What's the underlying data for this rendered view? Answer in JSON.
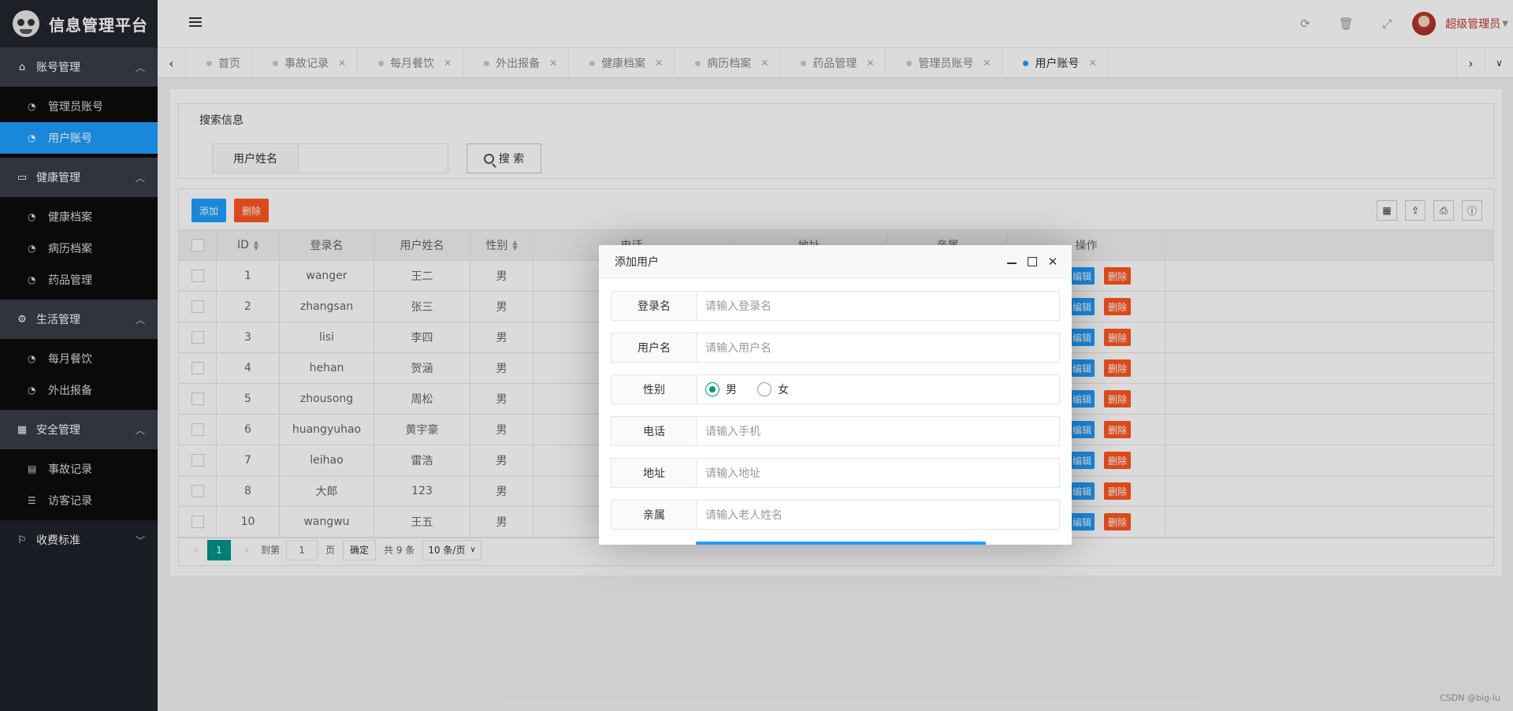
{
  "app": {
    "title": "信息管理平台"
  },
  "sidebar": {
    "groups": [
      {
        "label": "账号管理",
        "icon": "home-icon",
        "items": [
          {
            "label": "管理员账号",
            "icon": "dashboard-icon"
          },
          {
            "label": "用户账号",
            "icon": "dashboard-icon",
            "active": true
          }
        ]
      },
      {
        "label": "健康管理",
        "icon": "window-icon",
        "items": [
          {
            "label": "健康档案",
            "icon": "dashboard-icon"
          },
          {
            "label": "病历档案",
            "icon": "dashboard-icon"
          },
          {
            "label": "药品管理",
            "icon": "dashboard-icon"
          }
        ]
      },
      {
        "label": "生活管理",
        "icon": "gears-icon",
        "items": [
          {
            "label": "每月餐饮",
            "icon": "dashboard-icon"
          },
          {
            "label": "外出报备",
            "icon": "dashboard-icon"
          }
        ]
      },
      {
        "label": "安全管理",
        "icon": "calendar-icon",
        "items": [
          {
            "label": "事故记录",
            "icon": "list-alt-icon"
          },
          {
            "label": "访客记录",
            "icon": "list-icon"
          }
        ]
      },
      {
        "label": "收费标准",
        "icon": "flag-icon",
        "items": []
      }
    ]
  },
  "header": {
    "admin_name": "超级管理员"
  },
  "tabs": [
    {
      "label": "首页"
    },
    {
      "label": "事故记录"
    },
    {
      "label": "每月餐饮"
    },
    {
      "label": "外出报备"
    },
    {
      "label": "健康档案"
    },
    {
      "label": "病历档案"
    },
    {
      "label": "药品管理"
    },
    {
      "label": "管理员账号"
    },
    {
      "label": "用户账号",
      "active": true
    }
  ],
  "search": {
    "legend": "搜索信息",
    "label": "用户姓名",
    "value": "",
    "button": "搜 索"
  },
  "toolbar": {
    "add_label": "添加",
    "delete_label": "删除"
  },
  "table": {
    "headers": {
      "id": "ID",
      "login": "登录名",
      "name": "用户姓名",
      "sex": "性别",
      "phone": "电话",
      "addr": "地址",
      "rel": "亲属",
      "op": "操作"
    },
    "edit_label": "编辑",
    "delete_label": "删除",
    "rows": [
      {
        "id": "1",
        "login": "wanger",
        "name": "王二",
        "sex": "男"
      },
      {
        "id": "2",
        "login": "zhangsan",
        "name": "张三",
        "sex": "男"
      },
      {
        "id": "3",
        "login": "lisi",
        "name": "李四",
        "sex": "男"
      },
      {
        "id": "4",
        "login": "hehan",
        "name": "贺涵",
        "sex": "男"
      },
      {
        "id": "5",
        "login": "zhousong",
        "name": "周松",
        "sex": "男"
      },
      {
        "id": "6",
        "login": "huangyuhao",
        "name": "黄宇豪",
        "sex": "男"
      },
      {
        "id": "7",
        "login": "leihao",
        "name": "雷浩",
        "sex": "男"
      },
      {
        "id": "8",
        "login": "大郎",
        "name": "123",
        "sex": "男"
      },
      {
        "id": "10",
        "login": "wangwu",
        "name": "王五",
        "sex": "男"
      }
    ]
  },
  "pager": {
    "current": "1",
    "goto_label": "到第",
    "goto_value": "1",
    "page_unit": "页",
    "confirm": "确定",
    "total": "共 9 条",
    "page_size": "10 条/页"
  },
  "modal": {
    "title": "添加用户",
    "fields": [
      {
        "label": "登录名",
        "placeholder": "请输入登录名"
      },
      {
        "label": "用户名",
        "placeholder": "请输入用户名"
      },
      {
        "label": "性别",
        "options": [
          "男",
          "女"
        ],
        "selected": "男"
      },
      {
        "label": "电话",
        "placeholder": "请输入手机"
      },
      {
        "label": "地址",
        "placeholder": "请输入地址"
      },
      {
        "label": "亲属",
        "placeholder": "请输入老人姓名"
      }
    ]
  },
  "watermark": "CSDN @big-lu",
  "colors": {
    "primary": "#1e9fff",
    "danger": "#ff5722",
    "teal": "#009688",
    "sidebar": "#20222a"
  }
}
